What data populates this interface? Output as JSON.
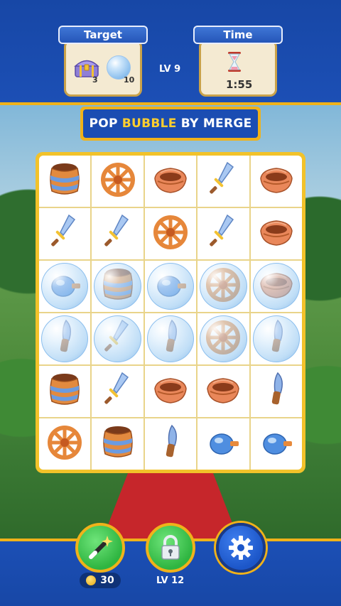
{
  "header": {
    "target_label": "Target",
    "time_label": "Time",
    "level": "LV 9",
    "timer": "1:55",
    "targets": [
      {
        "icon": "treasure-chest-icon",
        "count": "3"
      },
      {
        "icon": "bubble-icon",
        "count": "10"
      }
    ]
  },
  "banner": {
    "pre": "POP",
    "highlight": "BUBBLE",
    "post": "BY MERGE"
  },
  "board": {
    "columns": 5,
    "rows": 6,
    "cells": [
      {
        "item": "barrel",
        "bubble": false
      },
      {
        "item": "wheel",
        "bubble": false
      },
      {
        "item": "basket",
        "bubble": false
      },
      {
        "item": "sword",
        "bubble": false
      },
      {
        "item": "basket",
        "bubble": false
      },
      {
        "item": "sword",
        "bubble": false
      },
      {
        "item": "sword",
        "bubble": false
      },
      {
        "item": "wheel",
        "bubble": false
      },
      {
        "item": "sword",
        "bubble": false
      },
      {
        "item": "basket",
        "bubble": false
      },
      {
        "item": "bottle",
        "bubble": true
      },
      {
        "item": "barrel",
        "bubble": true
      },
      {
        "item": "bottle",
        "bubble": true
      },
      {
        "item": "wheel",
        "bubble": true
      },
      {
        "item": "basket",
        "bubble": true
      },
      {
        "item": "knife",
        "bubble": true
      },
      {
        "item": "sword",
        "bubble": true
      },
      {
        "item": "knife",
        "bubble": true
      },
      {
        "item": "wheel",
        "bubble": true
      },
      {
        "item": "knife",
        "bubble": true
      },
      {
        "item": "barrel",
        "bubble": false
      },
      {
        "item": "sword",
        "bubble": false
      },
      {
        "item": "basket",
        "bubble": false
      },
      {
        "item": "basket",
        "bubble": false
      },
      {
        "item": "knife",
        "bubble": false
      },
      {
        "item": "wheel",
        "bubble": false
      },
      {
        "item": "barrel",
        "bubble": false
      },
      {
        "item": "knife",
        "bubble": false
      },
      {
        "item": "bottle",
        "bubble": false
      },
      {
        "item": "bottle",
        "bubble": false
      }
    ]
  },
  "footer": {
    "coins": "30",
    "lock_level": "LV 12",
    "buttons": [
      {
        "icon": "magic-wand-icon"
      },
      {
        "icon": "lock-icon"
      },
      {
        "icon": "gear-icon"
      }
    ]
  },
  "colors": {
    "header_blue": "#1747a6",
    "gold_border": "#f0b21a",
    "highlight_yellow": "#ffcf2e",
    "button_green": "#2fb541",
    "button_blue": "#1c56c8"
  }
}
